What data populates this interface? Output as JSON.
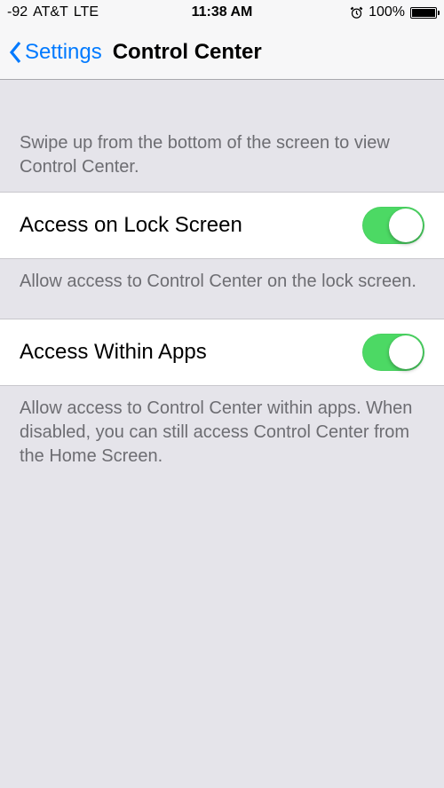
{
  "statusBar": {
    "signal": "-92",
    "carrier": "AT&T",
    "network": "LTE",
    "time": "11:38 AM",
    "batteryPct": "100%"
  },
  "nav": {
    "backLabel": "Settings",
    "title": "Control Center"
  },
  "intro": "Swipe up from the bottom of the screen to view Control Center.",
  "rows": {
    "lock": {
      "label": "Access on Lock Screen",
      "footer": "Allow access to Control Center on the lock screen."
    },
    "apps": {
      "label": "Access Within Apps",
      "footer": "Allow access to Control Center within apps. When disabled, you can still access Control Center from the Home Screen."
    }
  }
}
